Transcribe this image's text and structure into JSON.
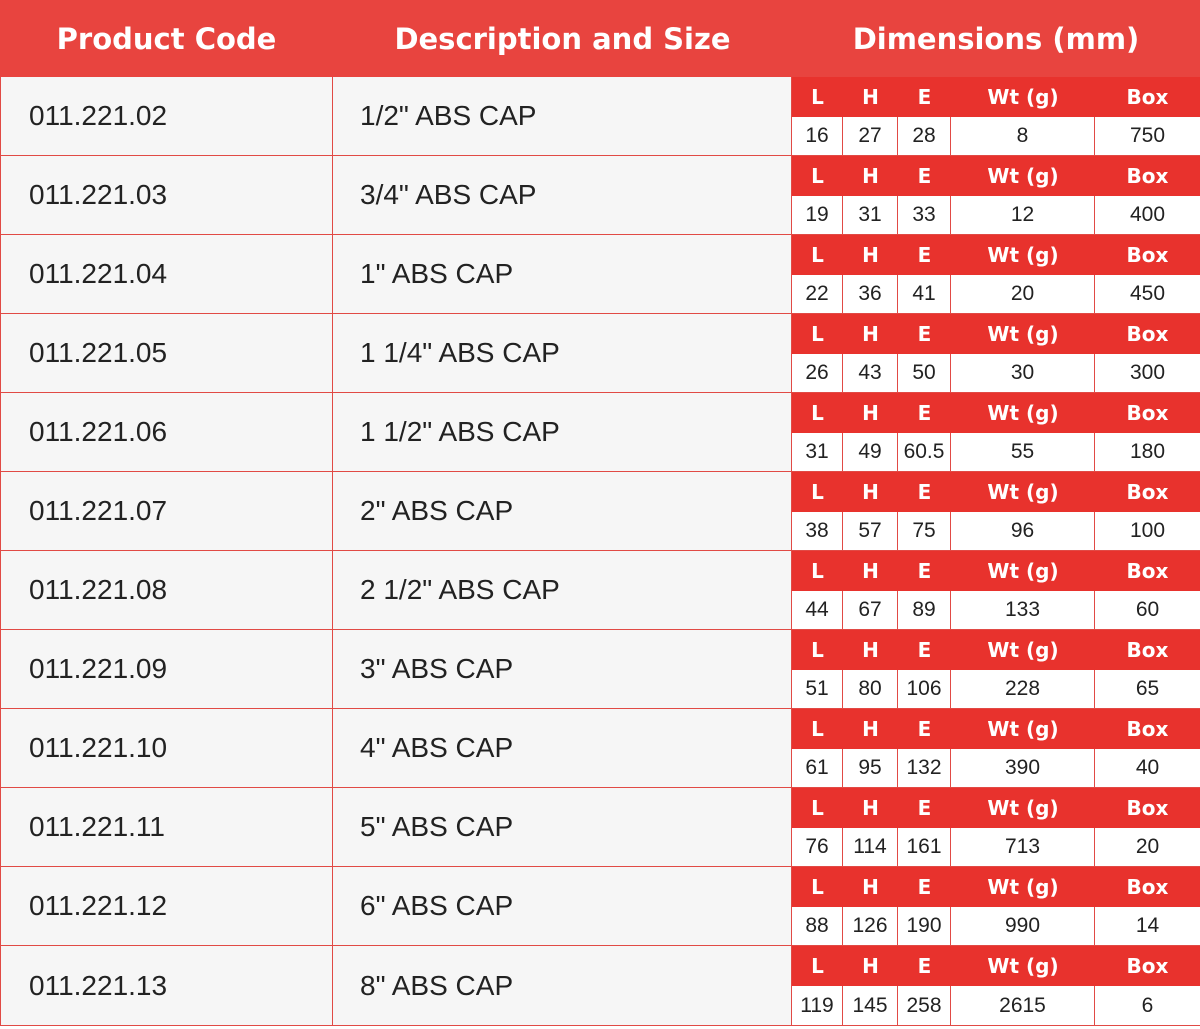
{
  "header": {
    "product_code": "Product Code",
    "description": "Description and Size",
    "dimensions": "Dimensions (mm)"
  },
  "dim_labels": {
    "l": "L",
    "h": "H",
    "e": "E",
    "wt": "Wt (g)",
    "box": "Box"
  },
  "rows": [
    {
      "code": "011.221.02",
      "desc": "1/2\" ABS CAP",
      "l": "16",
      "h": "27",
      "e": "28",
      "wt": "8",
      "box": "750"
    },
    {
      "code": "011.221.03",
      "desc": "3/4\" ABS CAP",
      "l": "19",
      "h": "31",
      "e": "33",
      "wt": "12",
      "box": "400"
    },
    {
      "code": "011.221.04",
      "desc": "1\" ABS CAP",
      "l": "22",
      "h": "36",
      "e": "41",
      "wt": "20",
      "box": "450"
    },
    {
      "code": "011.221.05",
      "desc": "1 1/4\" ABS CAP",
      "l": "26",
      "h": "43",
      "e": "50",
      "wt": "30",
      "box": "300"
    },
    {
      "code": "011.221.06",
      "desc": "1 1/2\" ABS CAP",
      "l": "31",
      "h": "49",
      "e": "60.5",
      "wt": "55",
      "box": "180"
    },
    {
      "code": "011.221.07",
      "desc": "2\" ABS CAP",
      "l": "38",
      "h": "57",
      "e": "75",
      "wt": "96",
      "box": "100"
    },
    {
      "code": "011.221.08",
      "desc": "2 1/2\" ABS CAP",
      "l": "44",
      "h": "67",
      "e": "89",
      "wt": "133",
      "box": "60"
    },
    {
      "code": "011.221.09",
      "desc": "3\" ABS CAP",
      "l": "51",
      "h": "80",
      "e": "106",
      "wt": "228",
      "box": "65"
    },
    {
      "code": "011.221.10",
      "desc": "4\" ABS CAP",
      "l": "61",
      "h": "95",
      "e": "132",
      "wt": "390",
      "box": "40"
    },
    {
      "code": "011.221.11",
      "desc": "5\" ABS CAP",
      "l": "76",
      "h": "114",
      "e": "161",
      "wt": "713",
      "box": "20"
    },
    {
      "code": "011.221.12",
      "desc": "6\" ABS CAP",
      "l": "88",
      "h": "126",
      "e": "190",
      "wt": "990",
      "box": "14"
    },
    {
      "code": "011.221.13",
      "desc": "8\" ABS CAP",
      "l": "119",
      "h": "145",
      "e": "258",
      "wt": "2615",
      "box": "6"
    }
  ]
}
